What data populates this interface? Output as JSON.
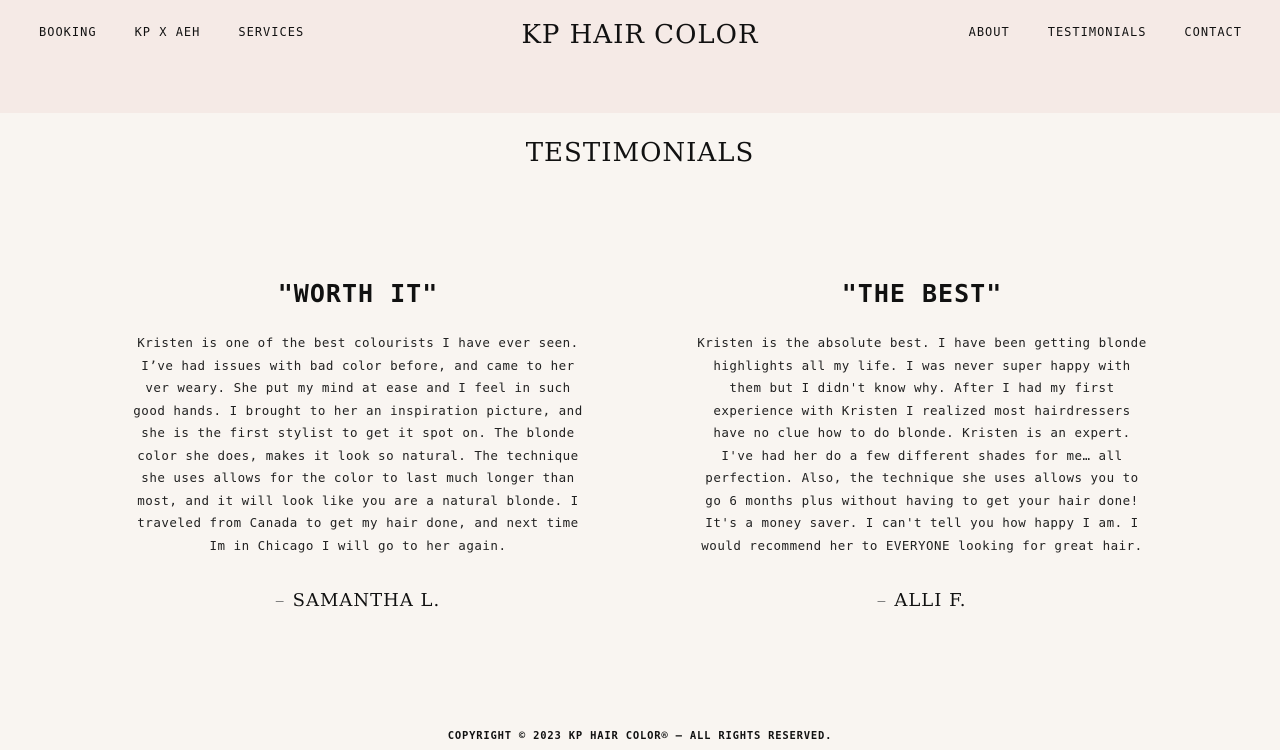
{
  "header": {
    "brand": "KP HAIR COLOR",
    "nav_left": [
      "BOOKING",
      "KP X AEH",
      "SERVICES"
    ],
    "nav_right": [
      "ABOUT",
      "TESTIMONIALS",
      "CONTACT"
    ]
  },
  "main": {
    "title": "TESTIMONIALS",
    "testimonials": [
      {
        "heading": "\"WORTH IT\"",
        "body": "Kristen is one of the best colourists I have ever seen. I’ve had issues with bad color before, and came to her ver weary. She put my mind at ease and I feel in such good hands. I brought to her an inspiration picture, and she is the first stylist to get it spot on. The blonde color she does, makes it look so natural. The technique she uses allows for the color to last much longer than most, and it will look like you are a natural blonde. I traveled from Canada to get my hair done, and next time Im in Chicago I will go to her again.",
        "dash": "–",
        "author": "SAMANTHA L."
      },
      {
        "heading": "\"THE BEST\"",
        "body": "Kristen is the absolute best. I have been getting blonde highlights all my life. I was never super happy with them but I didn't know why. After I had my first experience with Kristen I realized most hairdressers have no clue how to do blonde. Kristen is an expert. I've had her do a few different shades for me… all perfection. Also, the technique she uses allows you to go 6 months plus without having to get your hair done! It's a money saver. I can't tell you how happy I am. I would recommend her to EVERYONE looking for great hair.",
        "dash": "–",
        "author": "ALLI F."
      }
    ]
  },
  "footer": {
    "copyright": "COPYRIGHT © 2023 KP HAIR COLOR® — ALL RIGHTS RESERVED."
  },
  "colors": {
    "header_bg": "#f5eae6",
    "page_bg": "#f9f5f1",
    "text": "#111111"
  }
}
